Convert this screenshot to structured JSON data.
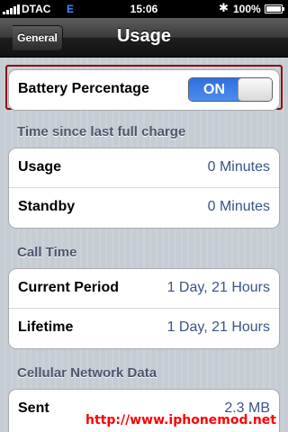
{
  "status_bar": {
    "carrier": "DTAC",
    "network": "E",
    "time": "15:06",
    "battery_percent": "100%",
    "bluetooth_icon": "bluetooth-icon"
  },
  "nav": {
    "back_label": "General",
    "title": "Usage"
  },
  "battery_percentage": {
    "label": "Battery Percentage",
    "switch_state": "ON",
    "switch_color": "#3a7be8"
  },
  "sections": {
    "time_since_charge": {
      "header": "Time since last full charge",
      "rows": [
        {
          "label": "Usage",
          "value": "0 Minutes"
        },
        {
          "label": "Standby",
          "value": "0 Minutes"
        }
      ]
    },
    "call_time": {
      "header": "Call Time",
      "rows": [
        {
          "label": "Current Period",
          "value": "1 Day, 21 Hours"
        },
        {
          "label": "Lifetime",
          "value": "1 Day, 21 Hours"
        }
      ]
    },
    "cellular": {
      "header": "Cellular Network Data",
      "rows": [
        {
          "label": "Sent",
          "value": "2.3 MB"
        }
      ]
    }
  },
  "watermark": "http://www.iphonemod.net",
  "colors": {
    "value_text": "#385487",
    "section_header": "#4c566c",
    "highlight_border": "#8a0a0a"
  }
}
